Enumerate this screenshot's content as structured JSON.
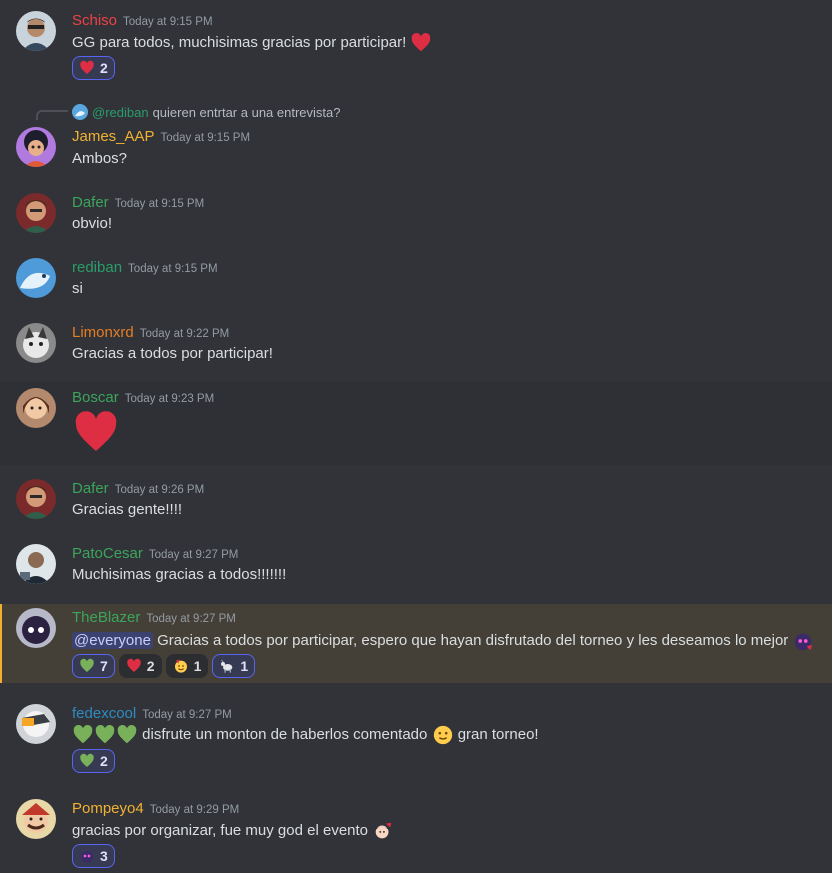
{
  "colors": {
    "green_name": "#3ba55c",
    "red_name": "#ed4245",
    "yellow_name": "#f0b232",
    "orange_name": "#e67e22",
    "blue_name": "#2e8bc0",
    "teal_name": "#2a9d6a"
  },
  "messages": {
    "m1": {
      "user": "Schiso",
      "time": "Today at 9:15 PM",
      "text": "GG para todos, muchisimas gracias por participar!",
      "r1": "2"
    },
    "m2": {
      "reply_user": "@rediban",
      "reply_text": "quieren entrtar a una entrevista?",
      "user": "James_AAP",
      "time": "Today at 9:15 PM",
      "text": "Ambos?"
    },
    "m3": {
      "user": "Dafer",
      "time": "Today at 9:15 PM",
      "text": "obvio!"
    },
    "m4": {
      "user": "rediban",
      "time": "Today at 9:15 PM",
      "text": "si"
    },
    "m5": {
      "user": "Limonxrd",
      "time": "Today at 9:22 PM",
      "text": "Gracias a todos por participar!"
    },
    "m6": {
      "user": "Boscar",
      "time": "Today at 9:23 PM"
    },
    "m7": {
      "user": "Dafer",
      "time": "Today at 9:26 PM",
      "text": "Gracias gente!!!!"
    },
    "m8": {
      "user": "PatoCesar",
      "time": "Today at 9:27 PM",
      "text": "Muchisimas gracias a todos!!!!!!!"
    },
    "m9": {
      "user": "TheBlazer",
      "time": "Today at 9:27 PM",
      "mention": "@everyone",
      "text": "Gracias a todos por participar, espero que hayan disfrutado del torneo y les deseamos lo mejor",
      "r1": "7",
      "r2": "2",
      "r3": "1",
      "r4": "1"
    },
    "m10": {
      "user": "fedexcool",
      "time": "Today at 9:27 PM",
      "text1": "disfrute un monton de haberlos comentado",
      "text2": "gran torneo!",
      "r1": "2"
    },
    "m11": {
      "user": "Pompeyo4",
      "time": "Today at 9:29 PM",
      "text": "gracias por organizar, fue muy god el evento",
      "r1": "3"
    }
  }
}
